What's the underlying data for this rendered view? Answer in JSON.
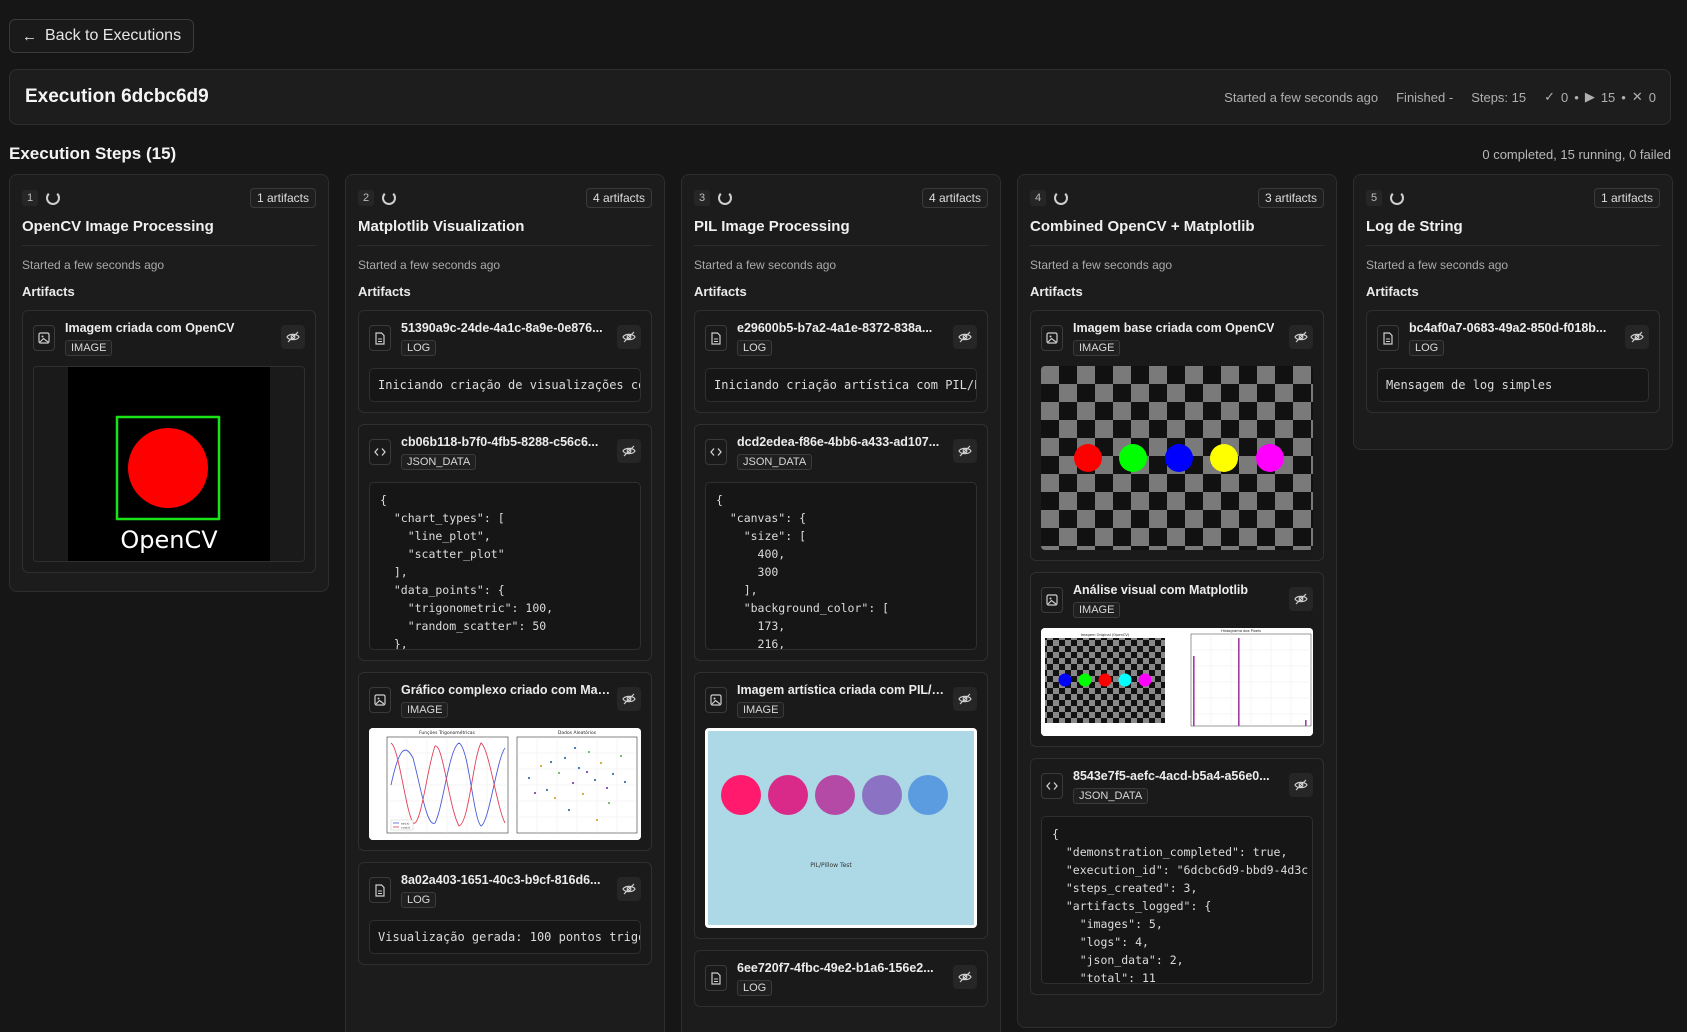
{
  "nav": {
    "back_label": "Back to Executions"
  },
  "execution": {
    "title": "Execution 6dcbc6d9",
    "started": "Started a few seconds ago",
    "finished": "Finished -",
    "steps": "Steps: 15",
    "completed": "0",
    "running": "15",
    "failed": "0"
  },
  "steps_header": {
    "title": "Execution Steps (15)",
    "summary": "0 completed, 15 running, 0 failed"
  },
  "labels": {
    "artifacts": "Artifacts"
  },
  "steps": [
    {
      "num": "1",
      "name": "OpenCV Image Processing",
      "artifacts_count": "1 artifacts",
      "started": "Started a few seconds ago",
      "artifacts": [
        {
          "title": "Imagem criada com OpenCV",
          "type": "IMAGE",
          "image_text": "OpenCV"
        }
      ]
    },
    {
      "num": "2",
      "name": "Matplotlib Visualization",
      "artifacts_count": "4 artifacts",
      "started": "Started a few seconds ago",
      "artifacts": [
        {
          "title": "51390a9c-24de-4a1c-8a9e-0e876...",
          "type": "LOG",
          "content": "Iniciando criação de visualizações co"
        },
        {
          "title": "cb06b118-b7f0-4fb5-8288-c56c6...",
          "type": "JSON_DATA",
          "content": "{\n  \"chart_types\": [\n    \"line_plot\",\n    \"scatter_plot\"\n  ],\n  \"data_points\": {\n    \"trigonometric\": 100,\n    \"random_scatter\": 50\n  },\n}"
        },
        {
          "title": "Gráfico complexo criado com Matp...",
          "type": "IMAGE",
          "image_titles": [
            "Funções Trigonométricas",
            "Dados Aleatórios"
          ],
          "legend": [
            "sin(x)",
            "cos(x)"
          ]
        },
        {
          "title": "8a02a403-1651-40c3-b9cf-816d6...",
          "type": "LOG",
          "content": "Visualização gerada: 100 pontos trigo"
        }
      ]
    },
    {
      "num": "3",
      "name": "PIL Image Processing",
      "artifacts_count": "4 artifacts",
      "started": "Started a few seconds ago",
      "artifacts": [
        {
          "title": "e29600b5-b7a2-4a1e-8372-838a...",
          "type": "LOG",
          "content": "Iniciando criação artística com PIL/P"
        },
        {
          "title": "dcd2edea-f86e-4bb6-a433-ad107...",
          "type": "JSON_DATA",
          "content": "{\n  \"canvas\": {\n    \"size\": [\n      400,\n      300\n    ],\n    \"background_color\": [\n      173,\n      216,"
        },
        {
          "title": "Imagem artística criada com PIL/Pil...",
          "type": "IMAGE",
          "image_text": "PIL/Pillow Test"
        },
        {
          "title": "6ee720f7-4fbc-49e2-b1a6-156e2...",
          "type": "LOG"
        }
      ]
    },
    {
      "num": "4",
      "name": "Combined OpenCV + Matplotlib",
      "artifacts_count": "3 artifacts",
      "started": "Started a few seconds ago",
      "artifacts": [
        {
          "title": "Imagem base criada com OpenCV",
          "type": "IMAGE"
        },
        {
          "title": "Análise visual com Matplotlib",
          "type": "IMAGE",
          "image_titles": [
            "Imagem Original (OpenCV)",
            "Histograma dos Pixels"
          ]
        },
        {
          "title": "8543e7f5-aefc-4acd-b5a4-a56e0...",
          "type": "JSON_DATA",
          "content": "{\n  \"demonstration_completed\": true,\n  \"execution_id\": \"6dcbc6d9-bbd9-4d3c\n  \"steps_created\": 3,\n  \"artifacts_logged\": {\n    \"images\": 5,\n    \"logs\": 4,\n    \"json_data\": 2,\n    \"total\": 11"
        }
      ]
    },
    {
      "num": "5",
      "name": "Log de String",
      "artifacts_count": "1 artifacts",
      "started": "Started a few seconds ago",
      "artifacts": [
        {
          "title": "bc4af0a7-0683-49a2-850d-f018b...",
          "type": "LOG",
          "content": "Mensagem de log simples"
        }
      ]
    }
  ]
}
